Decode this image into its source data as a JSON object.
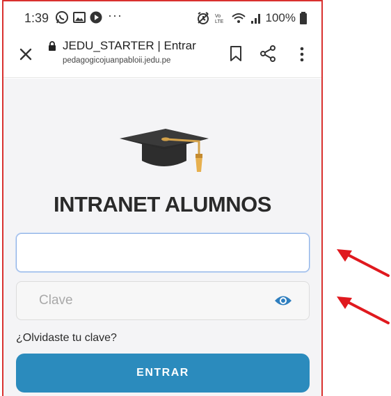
{
  "status_bar": {
    "time": "1:39",
    "more": "···",
    "battery": "100%"
  },
  "browser": {
    "title": "JEDU_STARTER | Entrar",
    "url": "pedagogicojuanpabloii.jedu.pe"
  },
  "page": {
    "heading": "INTRANET ALUMNOS",
    "username_value": "",
    "password_placeholder": "Clave",
    "forgot_link": "¿Olvidaste tu clave?",
    "submit_label": "ENTRAR"
  },
  "colors": {
    "frame_border": "#d9312f",
    "accent": "#2b8bbd",
    "arrow": "#e0191e",
    "background": "#f4f4f6"
  },
  "icons": [
    "whatsapp-icon",
    "gallery-icon",
    "play-icon",
    "alarm-icon",
    "lte-icon",
    "wifi-icon",
    "signal-icon",
    "battery-icon",
    "close-icon",
    "lock-icon",
    "bookmark-icon",
    "share-icon",
    "menu-icon",
    "graduation-cap-icon",
    "eye-icon",
    "arrow-icon"
  ]
}
